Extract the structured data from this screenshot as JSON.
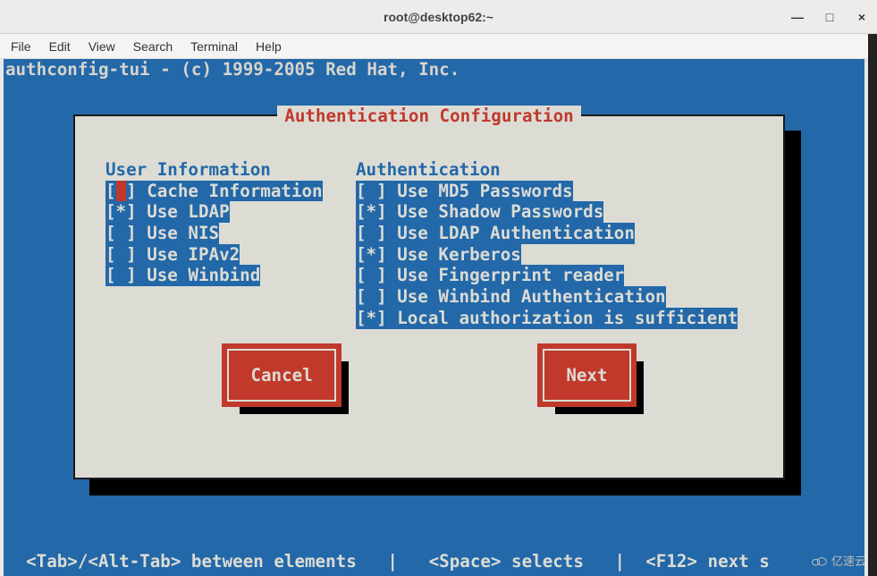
{
  "window": {
    "title": "root@desktop62:~",
    "controls": {
      "min": "—",
      "max": "□",
      "close": "×"
    }
  },
  "menubar": [
    "File",
    "Edit",
    "View",
    "Search",
    "Terminal",
    "Help"
  ],
  "app_header": "authconfig-tui - (c) 1999-2005 Red Hat, Inc.",
  "dialog": {
    "title": "Authentication Configuration",
    "left_header": "User Information",
    "left_options": [
      {
        "checked": false,
        "label": "Cache Information",
        "focused": true
      },
      {
        "checked": true,
        "label": "Use LDAP"
      },
      {
        "checked": false,
        "label": "Use NIS"
      },
      {
        "checked": false,
        "label": "Use IPAv2"
      },
      {
        "checked": false,
        "label": "Use Winbind"
      }
    ],
    "right_header": "Authentication",
    "right_options": [
      {
        "checked": false,
        "label": "Use MD5 Passwords"
      },
      {
        "checked": true,
        "label": "Use Shadow Passwords"
      },
      {
        "checked": false,
        "label": "Use LDAP Authentication"
      },
      {
        "checked": true,
        "label": "Use Kerberos"
      },
      {
        "checked": false,
        "label": "Use Fingerprint reader"
      },
      {
        "checked": false,
        "label": "Use Winbind Authentication"
      },
      {
        "checked": true,
        "label": "Local authorization is sufficient"
      }
    ],
    "buttons": {
      "cancel": "Cancel",
      "next": "Next"
    }
  },
  "footer": "  <Tab>/<Alt-Tab> between elements   |   <Space> selects   |  <F12> next s",
  "watermark": "亿速云"
}
